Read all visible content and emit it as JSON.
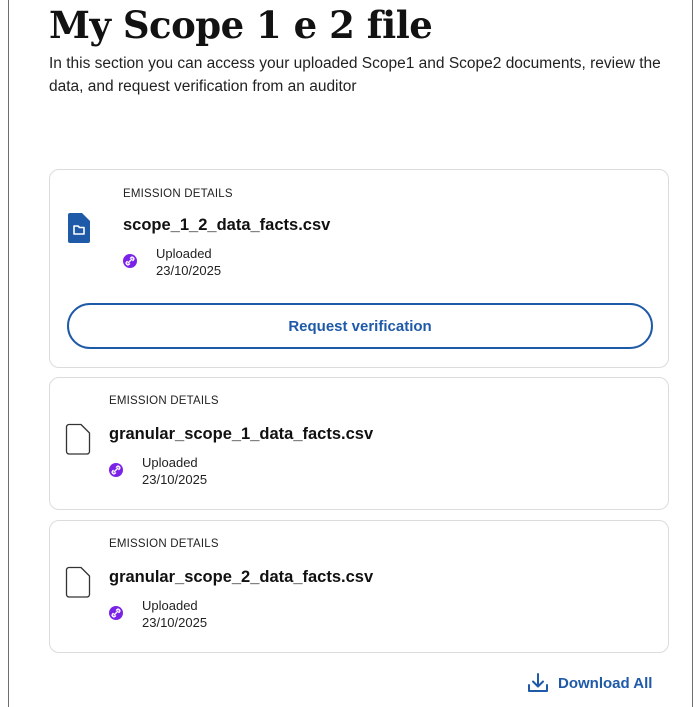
{
  "header": {
    "title": "My Scope 1 e 2 file",
    "intro": "In this section you can access your uploaded Scope1 and Scope2 documents, review the data, and request verification from an auditor"
  },
  "files": [
    {
      "eyebrow": "EMISSION DETAILS",
      "name": "scope_1_2_data_facts.csv",
      "status": "Uploaded",
      "date": "23/10/2025",
      "action_label": "Request verification",
      "icon": "document-solid-icon"
    },
    {
      "eyebrow": "EMISSION DETAILS",
      "name": "granular_scope_1_data_facts.csv",
      "status": "Uploaded",
      "date": "23/10/2025",
      "icon": "document-outline-icon"
    },
    {
      "eyebrow": "EMISSION DETAILS",
      "name": "granular_scope_2_data_facts.csv",
      "status": "Uploaded",
      "date": "23/10/2025",
      "icon": "document-outline-icon"
    }
  ],
  "footer": {
    "download_all_label": "Download All",
    "icon": "download-icon"
  },
  "colors": {
    "accent": "#1f5aa8",
    "link_dot": "#7b22e8",
    "card_border": "#dcdcdc"
  }
}
